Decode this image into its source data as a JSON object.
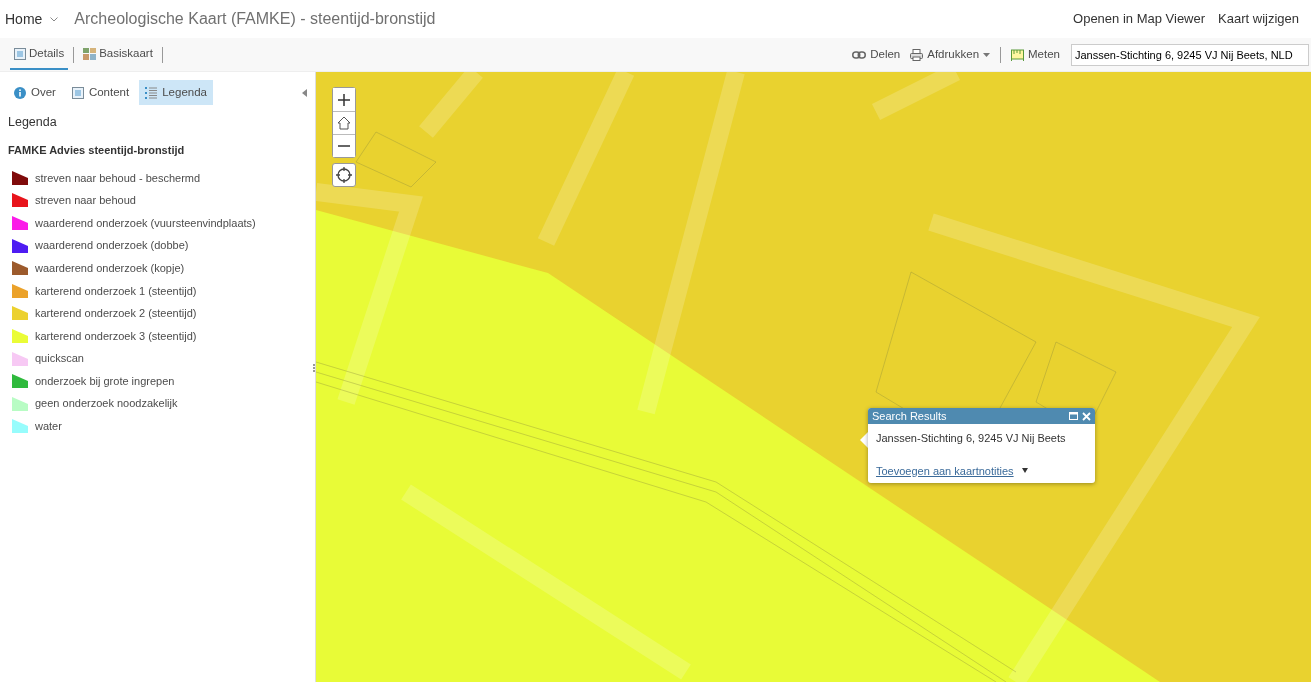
{
  "header": {
    "home": "Home",
    "title": "Archeologische Kaart (FAMKE) - steentijd-bronstijd",
    "links": [
      "Openen in Map Viewer",
      "Kaart wijzigen"
    ]
  },
  "toolbar": {
    "tabs": [
      {
        "label": "Details",
        "kind": "details",
        "selected": true
      },
      {
        "label": "Basiskaart",
        "kind": "basemap",
        "selected": false
      }
    ],
    "actions": [
      {
        "label": "Delen",
        "kind": "share"
      },
      {
        "label": "Afdrukken",
        "kind": "print"
      },
      {
        "label": "Meten",
        "kind": "measure"
      }
    ],
    "search": {
      "value": "Janssen-Stichting 6, 9245 VJ Nij Beets, NLD"
    }
  },
  "panel": {
    "tabs": [
      {
        "label": "Over",
        "kind": "about",
        "selected": false
      },
      {
        "label": "Content",
        "kind": "content",
        "selected": false
      },
      {
        "label": "Legenda",
        "kind": "legend",
        "selected": true
      }
    ],
    "heading": "Legenda",
    "layer": "FAMKE Advies steentijd-bronstijd",
    "legend": [
      {
        "label": "streven naar behoud - beschermd",
        "color": "#7f0a0a"
      },
      {
        "label": "streven naar behoud",
        "color": "#e8141b"
      },
      {
        "label": "waarderend onderzoek (vuursteenvindplaats)",
        "color": "#fb1ce8"
      },
      {
        "label": "waarderend onderzoek (dobbe)",
        "color": "#4e1cf2"
      },
      {
        "label": "waarderend onderzoek (kopje)",
        "color": "#9c5a2c"
      },
      {
        "label": "karterend onderzoek 1 (steentijd)",
        "color": "#eba22a"
      },
      {
        "label": "karterend onderzoek 2 (steentijd)",
        "color": "#ecd12f"
      },
      {
        "label": "karterend onderzoek 3 (steentijd)",
        "color": "#eafc37"
      },
      {
        "label": "quickscan",
        "color": "#f7c9f4"
      },
      {
        "label": "onderzoek bij grote ingrepen",
        "color": "#2fba3d"
      },
      {
        "label": "geen onderzoek noodzakelijk",
        "color": "#b8fcc4"
      },
      {
        "label": "water",
        "color": "#97fcfc"
      }
    ]
  },
  "popup": {
    "title": "Search Results",
    "address": "Janssen-Stichting 6, 9245 VJ Nij Beets",
    "link": "Toevoegen aan kaartnotities"
  }
}
